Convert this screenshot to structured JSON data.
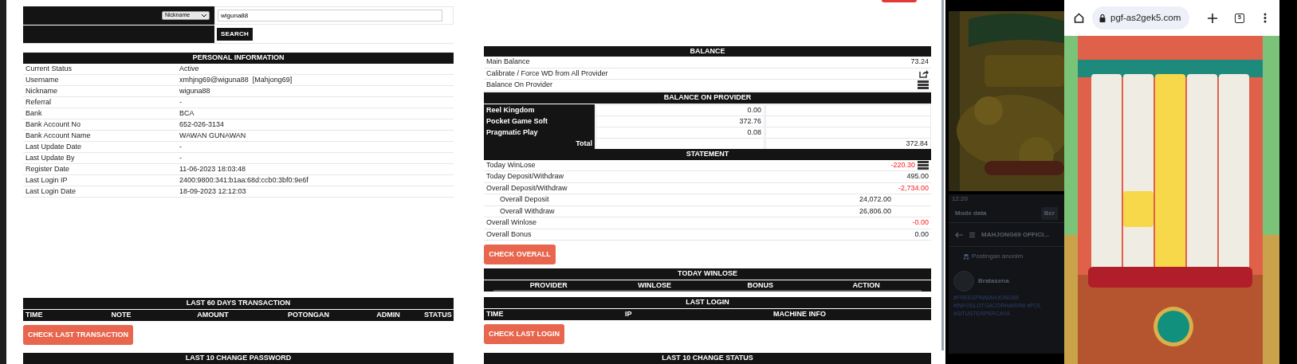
{
  "search": {
    "filter": "Nickname",
    "value": "wiguna88",
    "button": "SEARCH"
  },
  "personal_information": {
    "title": "PERSONAL INFORMATION",
    "rows": [
      {
        "label": "Current Status",
        "value": "Active"
      },
      {
        "label": "Username",
        "value": "xmhjng69@wiguna88  [Mahjong69]"
      },
      {
        "label": "Nickname",
        "value": "wiguna88"
      },
      {
        "label": "Referral",
        "value": "-"
      },
      {
        "label": "Bank",
        "value": "BCA"
      },
      {
        "label": "Bank Account No",
        "value": "652-026-3134"
      },
      {
        "label": "Bank Account Name",
        "value": "WAWAN GUNAWAN"
      },
      {
        "label": "Last Update Date",
        "value": "-"
      },
      {
        "label": "Last Update By",
        "value": "-"
      },
      {
        "label": "Register Date",
        "value": "11-06-2023 18:03:48"
      },
      {
        "label": "Last Login IP",
        "value": "2400:9800:341:b1aa:68d:ccb0:3bf0:9e6f"
      },
      {
        "label": "Last Login Date",
        "value": "18-09-2023 12:12:03"
      }
    ]
  },
  "last_60_days_transaction": {
    "title": "LAST 60 DAYS TRANSACTION",
    "columns": [
      "TIME",
      "NOTE",
      "AMOUNT",
      "POTONGAN",
      "ADMIN",
      "STATUS"
    ],
    "button": "CHECK LAST TRANSACTION"
  },
  "last_10_change_password": {
    "title": "LAST 10 CHANGE PASSWORD"
  },
  "balance": {
    "title": "BALANCE",
    "rows": [
      {
        "kind": "value",
        "label": "Main Balance",
        "value": "73.24"
      },
      {
        "kind": "share",
        "label": "Calibrate / Force WD from All Provider"
      },
      {
        "kind": "stack",
        "label": "Balance On Provider"
      }
    ]
  },
  "balance_on_provider": {
    "title": "BALANCE ON PROVIDER",
    "rows": [
      {
        "provider": "Reel Kingdom",
        "amount": "0.00"
      },
      {
        "provider": "Pocket Game Soft",
        "amount": "372.76"
      },
      {
        "provider": "Pragmatic Play",
        "amount": "0.08"
      }
    ],
    "total_label": "Total",
    "total": "372.84"
  },
  "statement": {
    "title": "STATEMENT",
    "rows": [
      {
        "kind": "stack",
        "label": "Today WinLose",
        "value": "-220.30",
        "negative": true
      },
      {
        "kind": "value",
        "label": "Today Deposit/Withdraw",
        "value": "495.00",
        "negative": false
      },
      {
        "kind": "value",
        "label": "Overall Deposit/Withdraw",
        "value": "-2,734.00",
        "negative": true
      },
      {
        "kind": "sub",
        "label": "Overall Deposit",
        "value": "24,072.00",
        "negative": false
      },
      {
        "kind": "sub",
        "label": "Overall Withdraw",
        "value": "26,806.00",
        "negative": false
      },
      {
        "kind": "value",
        "label": "Overall Winlose",
        "value": "-0.00",
        "negative": true
      },
      {
        "kind": "value",
        "label": "Overall Bonus",
        "value": "0.00",
        "negative": false
      }
    ],
    "button": "CHECK OVERALL"
  },
  "today_winlose": {
    "title": "TODAY WINLOSE",
    "columns": [
      "PROVIDER",
      "WINLOSE",
      "BONUS",
      "ACTION"
    ]
  },
  "last_login": {
    "title": "LAST LOGIN",
    "columns": [
      "TIME",
      "IP",
      "MACHINE INFO"
    ],
    "button": "CHECK LAST LOGIN"
  },
  "last_10_change_status": {
    "title": "LAST 10 CHANGE STATUS"
  },
  "background_app": {
    "time": "12:20",
    "mode": "Mode data",
    "mode_button": "Ber",
    "group": "MAHJONG69 OFFICI...",
    "anonymous_post": "Postingan anonim",
    "author": "Bratasena",
    "hashtags": [
      "#FREESPINMAHJONG69",
      "#INFOSLOTGACORHARIINI #POL",
      "#SITUSTERPERCAYA"
    ]
  },
  "browser": {
    "url": "pgf-as2gek5.com",
    "tab_count": "5"
  }
}
